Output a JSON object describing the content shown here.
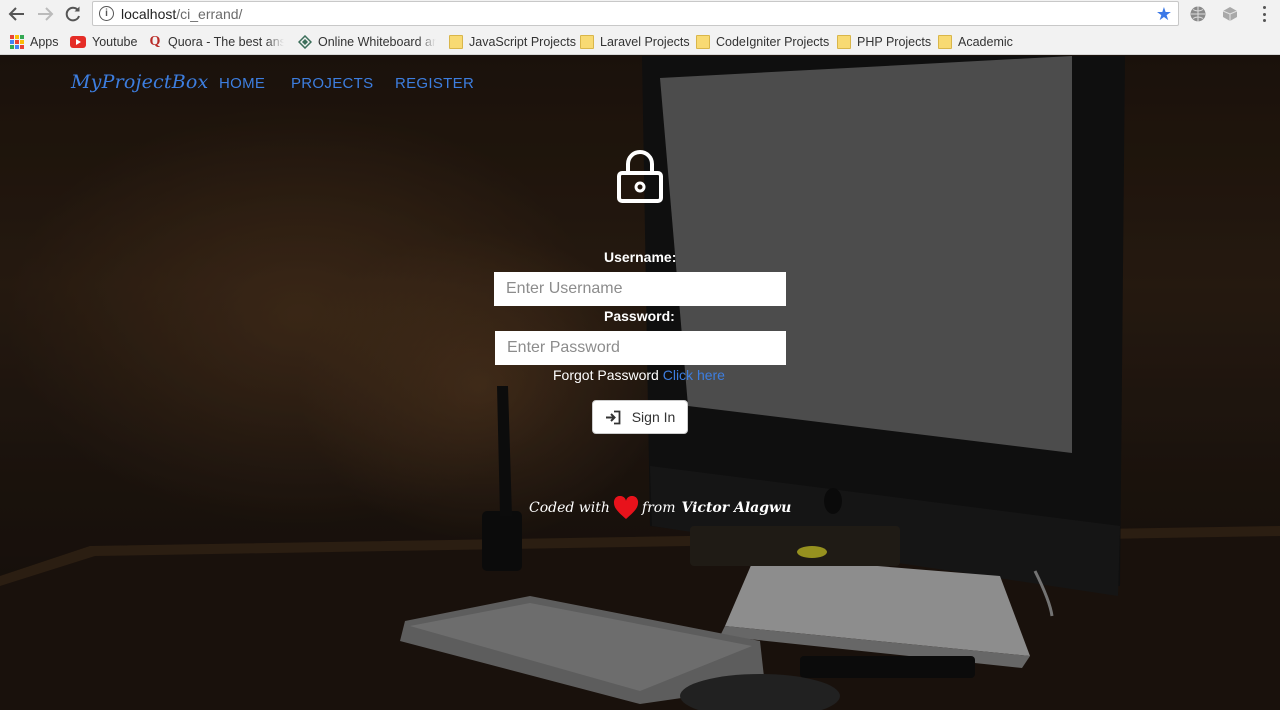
{
  "browser": {
    "url_host": "localhost",
    "url_path": "/ci_errand/",
    "bookmarks": [
      {
        "label": "Apps",
        "icon": "apps-icon"
      },
      {
        "label": "Youtube",
        "icon": "youtube-icon"
      },
      {
        "label": "Quora - The best answ",
        "icon": "quora-icon"
      },
      {
        "label": "Online Whiteboard an",
        "icon": "whiteboard-icon"
      },
      {
        "label": "JavaScript Projects",
        "icon": "folder-icon"
      },
      {
        "label": "Laravel Projects",
        "icon": "folder-icon"
      },
      {
        "label": "CodeIgniter Projects",
        "icon": "folder-icon"
      },
      {
        "label": "PHP Projects",
        "icon": "folder-icon"
      },
      {
        "label": "Academic",
        "icon": "folder-icon"
      }
    ]
  },
  "navbar": {
    "brand": "MyProjectBox",
    "links": [
      "HOME",
      "PROJECTS",
      "REGISTER"
    ]
  },
  "login": {
    "username_label": "Username:",
    "username_placeholder": "Enter Username",
    "password_label": "Password:",
    "password_placeholder": "Enter Password",
    "forgot_text": "Forgot Password",
    "forgot_link": "Click here",
    "signin_label": "Sign In"
  },
  "footer": {
    "prefix": "Coded with",
    "middle": "from",
    "author": "Victor Alagwu"
  },
  "colors": {
    "link_blue": "#3d7ee0",
    "heart_red": "#e8121b"
  }
}
